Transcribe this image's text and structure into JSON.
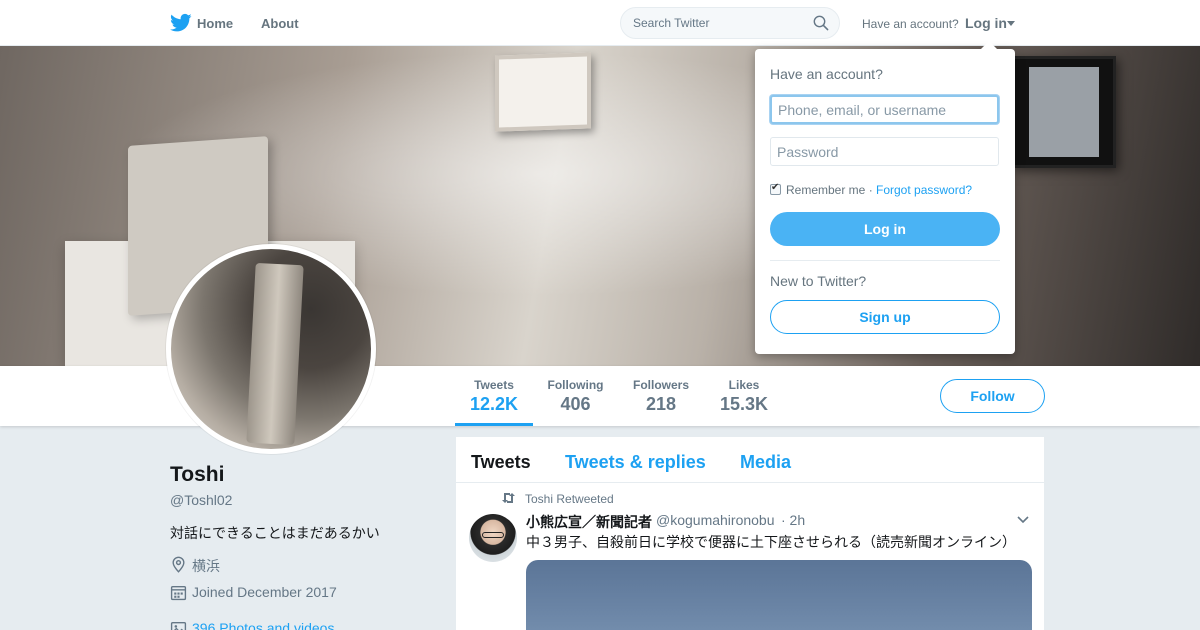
{
  "nav": {
    "home_label": "Home",
    "about_label": "About",
    "search_placeholder": "Search Twitter",
    "have_account": "Have an account?",
    "login_label": "Log in"
  },
  "profile": {
    "name": "Toshi",
    "handle": "@Toshl02",
    "bio": "対話にできることはまだあるかい",
    "location": "横浜",
    "joined": "Joined December 2017",
    "photos": "396 Photos and videos"
  },
  "stats": [
    {
      "label": "Tweets",
      "value": "12.2K"
    },
    {
      "label": "Following",
      "value": "406"
    },
    {
      "label": "Followers",
      "value": "218"
    },
    {
      "label": "Likes",
      "value": "15.3K"
    }
  ],
  "follow_label": "Follow",
  "timeline": {
    "tabs": [
      "Tweets",
      "Tweets & replies",
      "Media"
    ],
    "tweet": {
      "retweeted_by": "Toshi Retweeted",
      "author": "小熊広宣／新聞記者",
      "handle": "@kogumahironobu",
      "time": "· 2h",
      "text": "中３男子、自殺前日に学校で便器に土下座させられる（読売新聞オンライン）"
    }
  },
  "login_dropdown": {
    "title": "Have an account?",
    "username_placeholder": "Phone, email, or username",
    "password_placeholder": "Password",
    "remember_me": "Remember me ·",
    "forgot_password": "Forgot password?",
    "login_button": "Log in",
    "new_to_twitter": "New to Twitter?",
    "signup_button": "Sign up"
  },
  "colors": {
    "accent": "#1da1f2",
    "login_button": "#4ab3f4",
    "background": "#e6ecf0"
  }
}
